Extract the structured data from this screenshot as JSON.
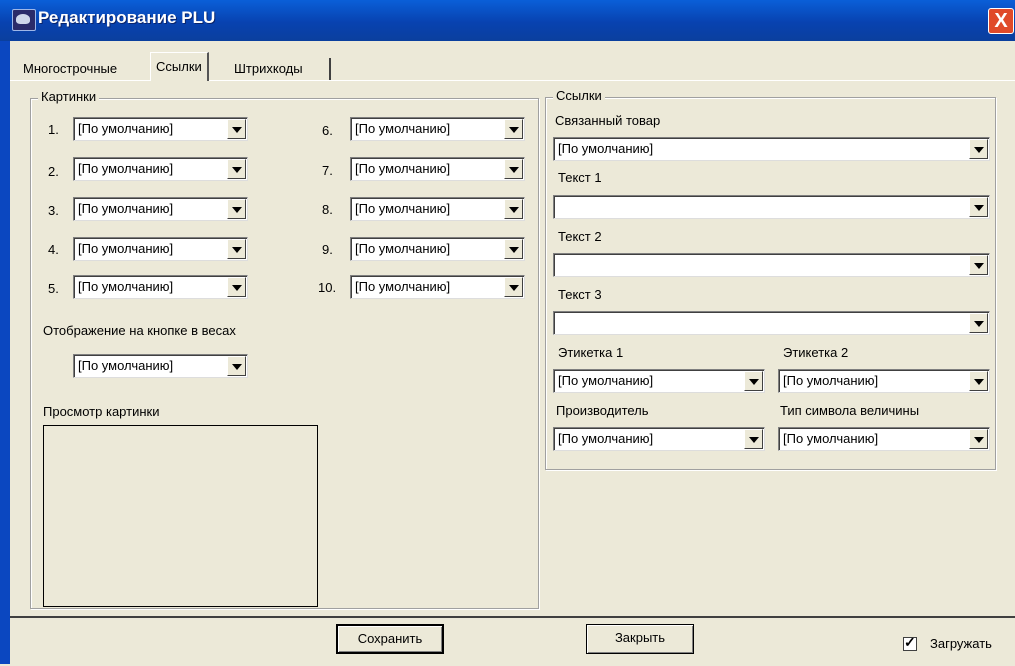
{
  "window": {
    "title": "Редактирование PLU",
    "close_label": "X"
  },
  "tabs": [
    {
      "label": "Многострочные"
    },
    {
      "label": "Ссылки",
      "active": true
    },
    {
      "label": "Штрихкоды"
    }
  ],
  "pictures": {
    "group_title": "Картинки",
    "rows": [
      {
        "num": "1.",
        "value": "[По умолчанию]"
      },
      {
        "num": "2.",
        "value": "[По умолчанию]"
      },
      {
        "num": "3.",
        "value": "[По умолчанию]"
      },
      {
        "num": "4.",
        "value": "[По умолчанию]"
      },
      {
        "num": "5.",
        "value": "[По умолчанию]"
      },
      {
        "num": "6.",
        "value": "[По умолчанию]"
      },
      {
        "num": "7.",
        "value": "[По умолчанию]"
      },
      {
        "num": "8.",
        "value": "[По умолчанию]"
      },
      {
        "num": "9.",
        "value": "[По умолчанию]"
      },
      {
        "num": "10.",
        "value": "[По умолчанию]"
      }
    ],
    "display_label": "Отображение на кнопке в весах",
    "display_value": "[По умолчанию]",
    "preview_label": "Просмотр картинки"
  },
  "links": {
    "group_title": "Ссылки",
    "related_label": "Связанный товар",
    "related_value": "[По умолчанию]",
    "text1_label": "Текст 1",
    "text1_value": "",
    "text2_label": "Текст 2",
    "text2_value": "",
    "text3_label": "Текст 3",
    "text3_value": "",
    "label1_label": "Этикетка 1",
    "label1_value": "[По умолчанию]",
    "label2_label": "Этикетка 2",
    "label2_value": "[По умолчанию]",
    "maker_label": "Производитель",
    "maker_value": "[По умолчанию]",
    "unit_label": "Тип символа величины",
    "unit_value": "[По умолчанию]"
  },
  "footer": {
    "save_label": "Сохранить",
    "close_label": "Закрыть",
    "load_label": "Загружать",
    "load_checked": true
  }
}
